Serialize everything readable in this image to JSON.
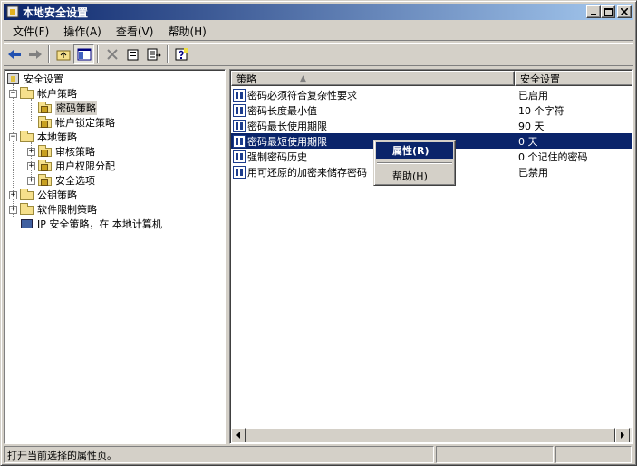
{
  "window": {
    "title": "本地安全设置"
  },
  "menubar": {
    "items": [
      {
        "label": "文件(F)"
      },
      {
        "label": "操作(A)"
      },
      {
        "label": "查看(V)"
      },
      {
        "label": "帮助(H)"
      }
    ]
  },
  "tree": {
    "root": "安全设置",
    "account_policies": "帐户策略",
    "password_policy": "密码策略",
    "lockout_policy": "帐户锁定策略",
    "local_policies": "本地策略",
    "audit_policy": "审核策略",
    "user_rights": "用户权限分配",
    "security_options": "安全选项",
    "public_key": "公钥策略",
    "software_restriction": "软件限制策略",
    "ip_security": "IP 安全策略，在 本地计算机"
  },
  "list": {
    "columns": [
      "策略",
      "安全设置"
    ],
    "rows": [
      {
        "policy": "密码必须符合复杂性要求",
        "setting": "已启用",
        "selected": false
      },
      {
        "policy": "密码长度最小值",
        "setting": "10 个字符",
        "selected": false
      },
      {
        "policy": "密码最长使用期限",
        "setting": "90 天",
        "selected": false
      },
      {
        "policy": "密码最短使用期限",
        "setting": "0 天",
        "selected": true
      },
      {
        "policy": "强制密码历史",
        "setting": "0 个记住的密码",
        "selected": false
      },
      {
        "policy": "用可还原的加密来储存密码",
        "setting": "已禁用",
        "selected": false
      }
    ]
  },
  "context_menu": {
    "properties": "属性(R)",
    "help": "帮助(H)"
  },
  "statusbar": {
    "text": "打开当前选择的属性页。"
  },
  "colors": {
    "selection": "#0a246a",
    "face": "#d4d0c8"
  }
}
